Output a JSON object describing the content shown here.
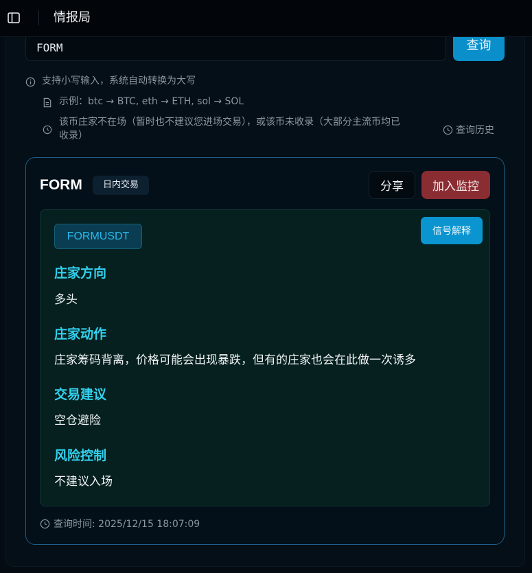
{
  "header": {
    "title": "情报局"
  },
  "search": {
    "value": "FORM",
    "button_label": "查询"
  },
  "hints": {
    "uppercase": "支持小写输入，系统自动转换为大写",
    "example": "示例：btc → BTC, eth → ETH, sol → SOL",
    "absent_line1": "该币庄家不在场（暂时也不建议您进场交易），或该币未收录（大部分主流币均已",
    "absent_line2": "收录）",
    "history_label": "查询历史"
  },
  "result": {
    "symbol": "FORM",
    "mode_badge": "日内交易",
    "share_label": "分享",
    "watch_label": "加入监控",
    "pair": "FORMUSDT",
    "explain_label": "信号解释",
    "sections": [
      {
        "title": "庄家方向",
        "content": "多头"
      },
      {
        "title": "庄家动作",
        "content": "庄家筹码背离，价格可能会出现暴跌，但有的庄家也会在此做一次诱多"
      },
      {
        "title": "交易建议",
        "content": "空仓避险"
      },
      {
        "title": "风险控制",
        "content": "不建议入场"
      }
    ],
    "query_time": "查询时间: 2025/12/15 18:07:09"
  },
  "colors": {
    "accent": "#0a8fca",
    "danger": "#8a2d33",
    "section_heading": "#33d0ee"
  }
}
